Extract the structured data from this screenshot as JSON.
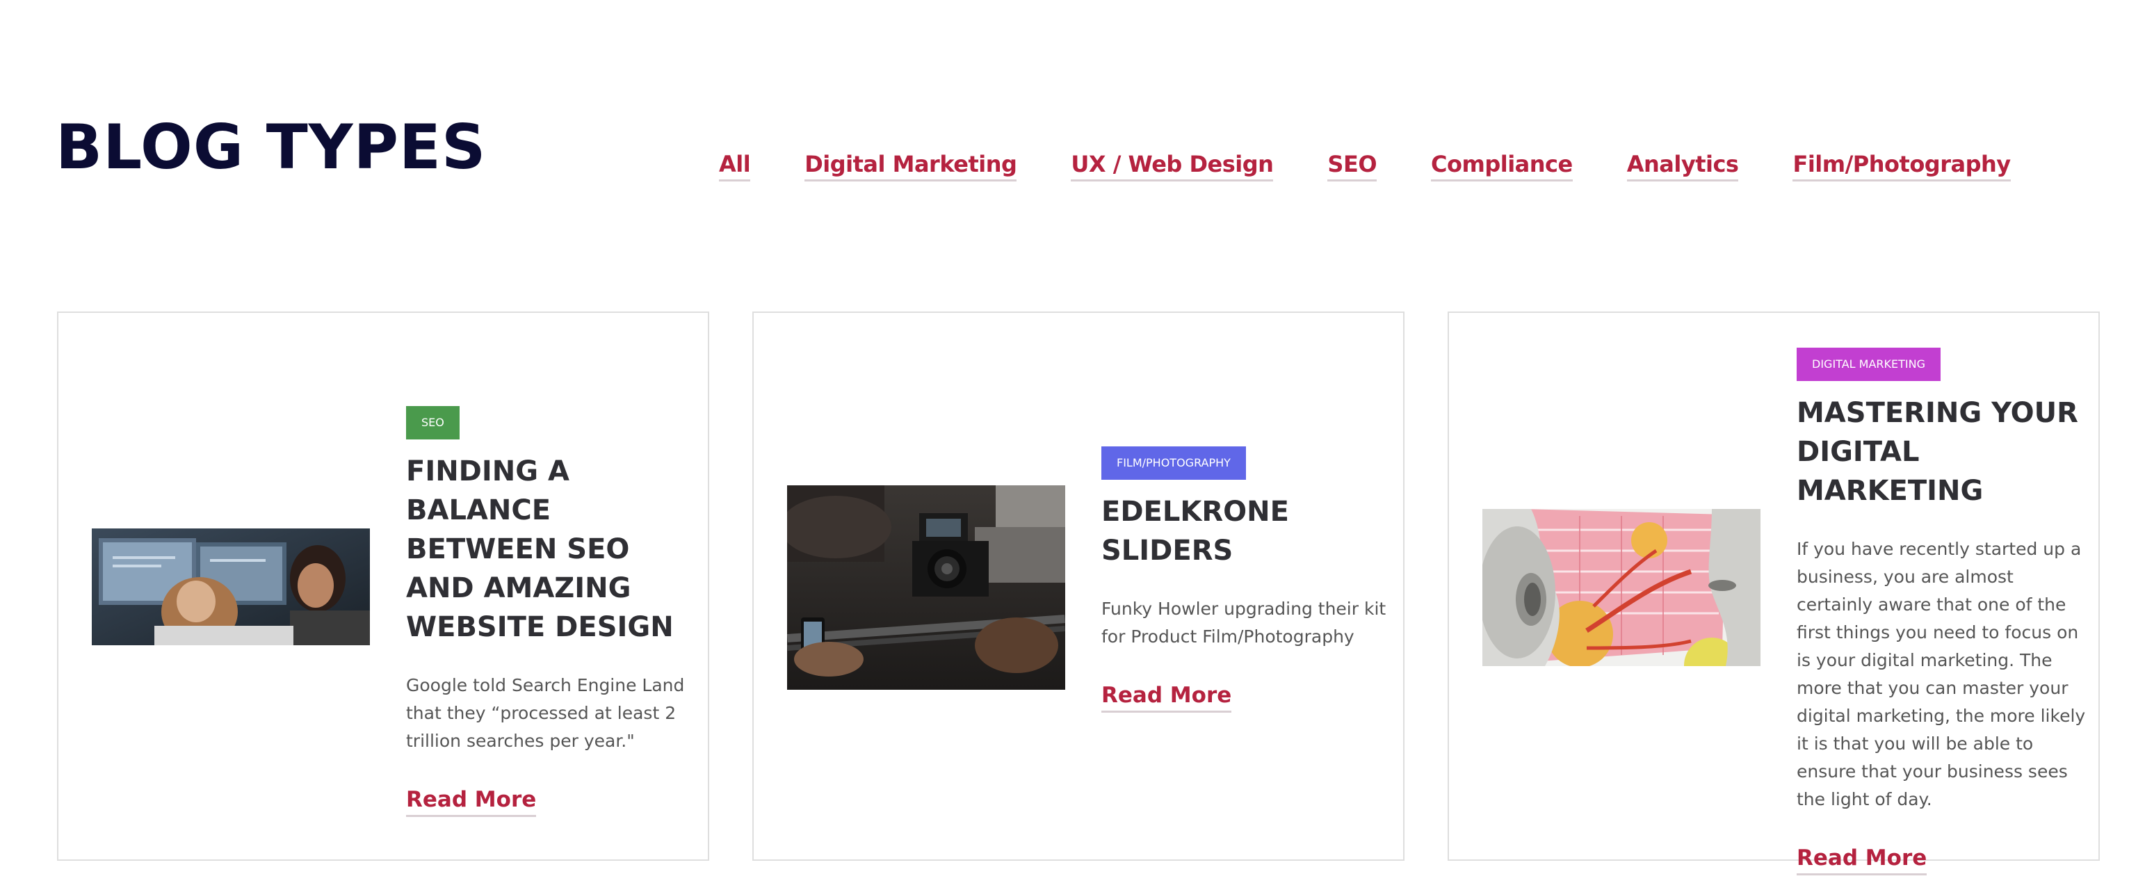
{
  "page": {
    "title": "BLOG TYPES"
  },
  "filters": {
    "items": [
      {
        "label": "All"
      },
      {
        "label": "Digital Marketing"
      },
      {
        "label": "UX / Web Design"
      },
      {
        "label": "SEO"
      },
      {
        "label": "Compliance"
      },
      {
        "label": "Analytics"
      },
      {
        "label": "Film/Photography"
      }
    ]
  },
  "cards": [
    {
      "category": "SEO",
      "category_color": "#4a9a4c",
      "title": "FINDING A BALANCE BETWEEN SEO AND AMAZING WEBSITE DESIGN",
      "excerpt": "Google told Search Engine Land that they “processed at least 2 trillion searches per year.\"",
      "cta": "Read More",
      "image": "people-at-computer-screens-photo"
    },
    {
      "category": "FILM/PHOTOGRAPHY",
      "category_color": "#6067e8",
      "title": "EDELKRONE SLIDERS",
      "excerpt": "Funky Howler upgrading their kit for Product Film/Photography",
      "cta": "Read More",
      "image": "camera-slider-rig-photo"
    },
    {
      "category": "DIGITAL MARKETING",
      "category_color": "#c23fd1",
      "title": "MASTERING YOUR DIGITAL MARKETING",
      "excerpt": "If you have recently started up a business, you are almost certainly aware that one of the first things you need to focus on is your digital marketing. The more that you can master your digital marketing, the more likely it is that you will be able to ensure that your business sees the light of day.",
      "cta": "Read More",
      "image": "whisper-collage-illustration"
    }
  ],
  "colors": {
    "heading": "#0b0c33",
    "link": "#b5223f",
    "card_title": "#2f2f34",
    "body_text": "#555555",
    "card_border": "#dedede"
  }
}
